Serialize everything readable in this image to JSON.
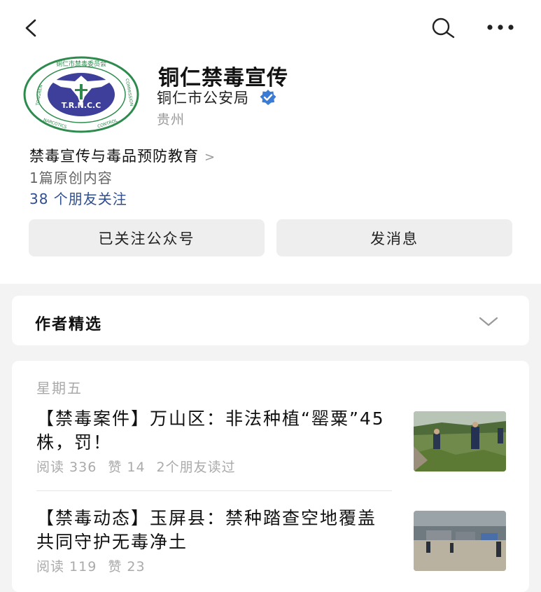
{
  "header": {
    "back_icon": "back-arrow-icon",
    "search_icon": "search-icon",
    "more_icon": "more-dots-icon"
  },
  "account": {
    "name": "铜仁禁毒宣传",
    "organization": "铜仁市公安局",
    "verified_icon": "verified-badge-icon",
    "region": "贵州",
    "description": "禁毒宣传与毒品预防教育",
    "description_chevron": ">",
    "original_count": "1篇原创内容",
    "friends_following": "38 个朋友关注",
    "verified_color": "#3a7bd5",
    "link_color": "#2f4e8f"
  },
  "logo": {
    "ring_top": "铜仁市禁毒委员会",
    "ring_left": "TONGREN",
    "ring_right": "COMMISSION",
    "ring_bottom_left": "NARCOTICS",
    "ring_bottom_right": "CONTROL",
    "center": "T.R.N.C.C",
    "ring_color": "#2e8b4e",
    "center_color": "#3d3f9a"
  },
  "actions": {
    "follow_label": "已关注公众号",
    "message_label": "发消息"
  },
  "featured": {
    "title": "作者精选",
    "chevron_icon": "chevron-down-icon"
  },
  "articles": {
    "day": "星期五",
    "items": [
      {
        "title": "【禁毒案件】万山区：非法种植“罂粟”45株，罚！",
        "reads": "阅读 336",
        "likes": "赞 14",
        "friends_read": "2个朋友读过"
      },
      {
        "title": "【禁毒动态】玉屏县：禁种踏查空地覆盖 共同守护无毒净土",
        "reads": "阅读 119",
        "likes": "赞 23",
        "friends_read": ""
      }
    ]
  }
}
